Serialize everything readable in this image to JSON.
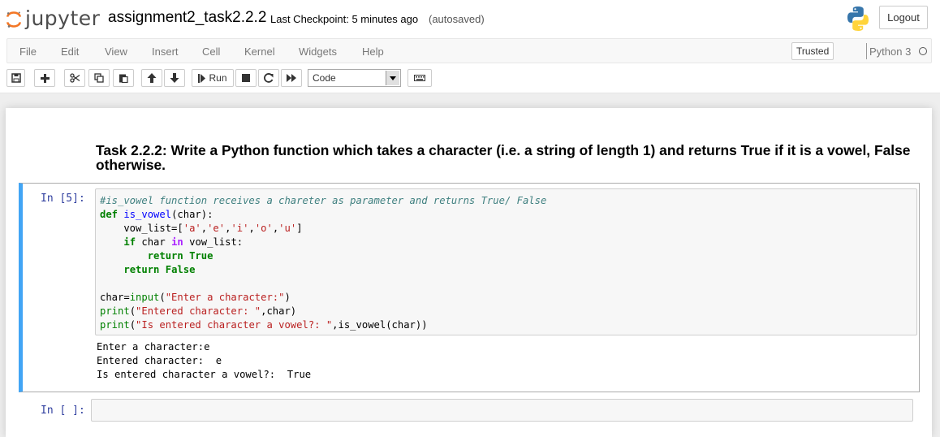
{
  "header": {
    "logo_text": "jupyter",
    "notebook_name": "assignment2_task2.2.2",
    "checkpoint": "Last Checkpoint: 5 minutes ago",
    "autosave": "(autosaved)",
    "logout_label": "Logout"
  },
  "menubar": {
    "items": [
      "File",
      "Edit",
      "View",
      "Insert",
      "Cell",
      "Kernel",
      "Widgets",
      "Help"
    ],
    "trusted_label": "Trusted",
    "kernel_name": "Python 3"
  },
  "toolbar": {
    "run_label": "Run",
    "cell_type": "Code",
    "icons": [
      "save-icon",
      "plus-icon",
      "cut-icon",
      "copy-icon",
      "paste-icon",
      "arrow-up-icon",
      "arrow-down-icon",
      "step-forward-icon",
      "stop-icon",
      "restart-icon",
      "fast-forward-icon",
      "keyboard-icon"
    ]
  },
  "notebook": {
    "heading": "Task 2.2.2: Write a Python function which takes a character (i.e. a string of length 1) and returns True if it is a vowel, False otherwise.",
    "cells": [
      {
        "prompt": "In [5]:",
        "code": [
          "#is_vowel function receives a chareter as parameter and returns True/ False",
          "def is_vowel(char):",
          "    vow_list=['a','e','i','o','u']",
          "    if char in vow_list:",
          "        return True",
          "    return False",
          "",
          "char=input(\"Enter a character:\")",
          "print(\"Entered character: \",char)",
          "print(\"Is entered character a vowel?: \",is_vowel(char))"
        ],
        "output": [
          "Enter a character:e",
          "Entered character:  e",
          "Is entered character a vowel?:  True"
        ]
      },
      {
        "prompt": "In [ ]:"
      }
    ]
  },
  "colors": {
    "active_cell_border": "#42a5f5",
    "prompt_color": "#303f9f",
    "comment_color": "#408080",
    "keyword_color": "#008000",
    "string_color": "#ba2121"
  }
}
